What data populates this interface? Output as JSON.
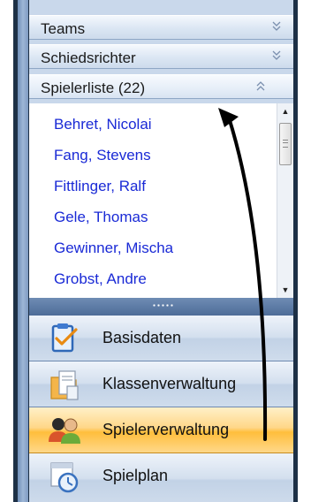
{
  "sections": {
    "teams": {
      "label": "Teams",
      "expanded": false
    },
    "schiedsrichter": {
      "label": "Schiedsrichter",
      "expanded": false
    },
    "spielerliste": {
      "label": "Spielerliste (22)",
      "expanded": true
    }
  },
  "players": [
    "Behret, Nicolai",
    "Fang, Stevens",
    "Fittlinger, Ralf",
    "Gele, Thomas",
    "Gewinner, Mischa",
    "Grobst, Andre"
  ],
  "nav": {
    "basisdaten": {
      "label": "Basisdaten",
      "icon": "clipboard-check-icon"
    },
    "klassenverwaltung": {
      "label": "Klassenverwaltung",
      "icon": "folder-document-icon"
    },
    "spielerverwaltung": {
      "label": "Spielerverwaltung",
      "icon": "users-icon",
      "selected": true
    },
    "spielplan": {
      "label": "Spielplan",
      "icon": "calendar-clock-icon"
    }
  },
  "colors": {
    "player_link": "#1a2ad6",
    "selected_nav": "#ffbe3c",
    "panel_header": "#dbe6f3",
    "splitter": "#5677a4"
  }
}
